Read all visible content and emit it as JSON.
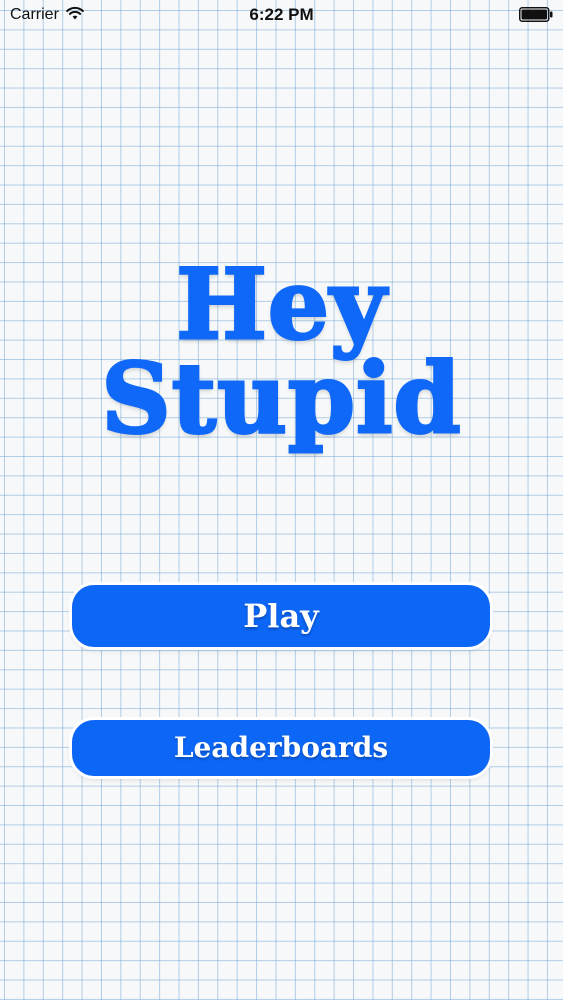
{
  "status_bar": {
    "carrier": "Carrier",
    "time": "6:22 PM",
    "wifi_icon": "wifi-icon",
    "battery_icon": "battery-icon"
  },
  "title": {
    "line1": "Hey",
    "line2": "Stupid",
    "color": "#0f68f7"
  },
  "menu": {
    "play_label": "Play",
    "leaderboards_label": "Leaderboards",
    "button_color": "#0c66f6"
  }
}
